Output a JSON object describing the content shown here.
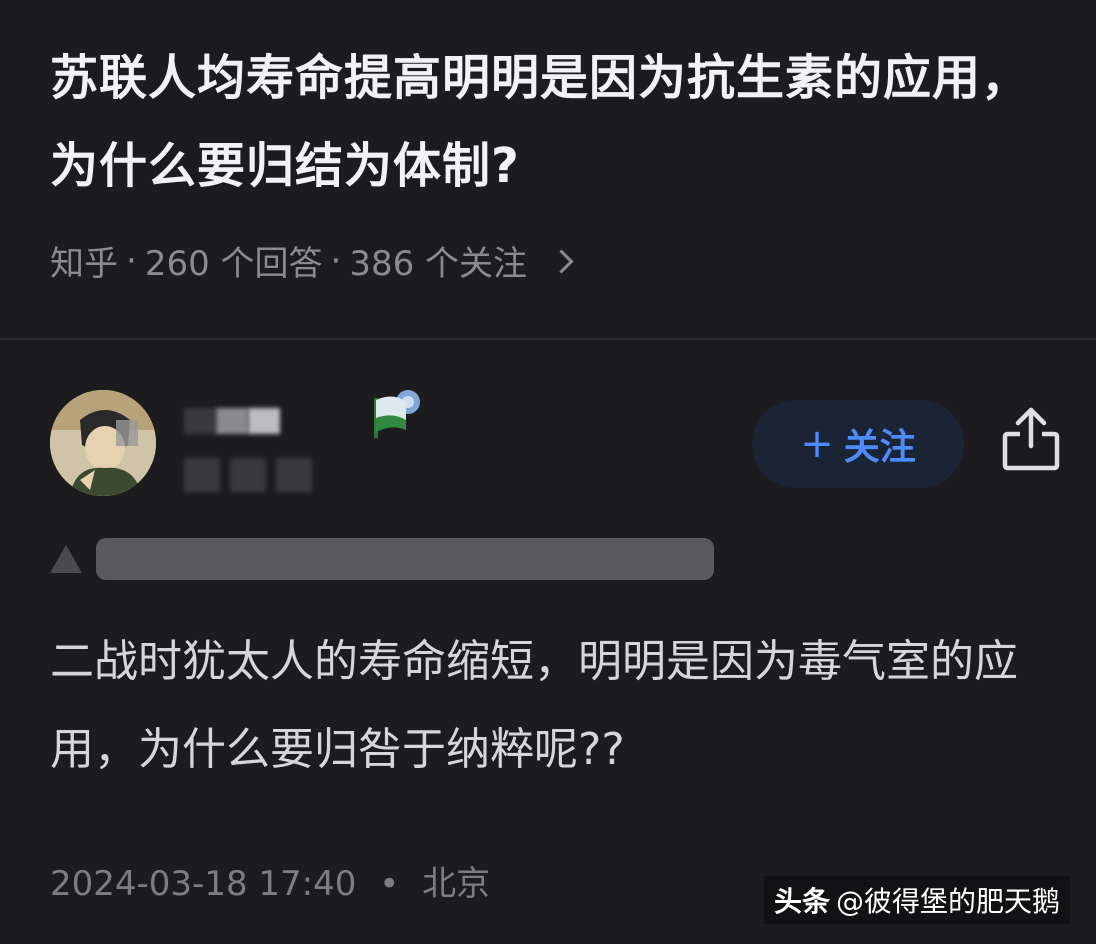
{
  "question": {
    "title": "苏联人均寿命提高明明是因为抗生素的应用，为什么要归结为体制?",
    "source": "知乎",
    "answers": "260 个回答",
    "followers": "386 个关注",
    "separator": "·"
  },
  "author": {
    "follow_button": "+ 关注",
    "follow_plus": "+",
    "follow_label": "关注"
  },
  "answer": {
    "text": "二战时犹太人的寿命缩短，明明是因为毒气室的应用，为什么要归咎于纳粹呢??",
    "date": "2024-03-18 17:40",
    "dot": "•",
    "location": "北京"
  },
  "watermark": {
    "brand": "头条",
    "handle": "@彼得堡的肥天鹅"
  },
  "colors": {
    "background": "#1c1c1f",
    "accent": "#4d8cff",
    "follow_bg": "#1b2434"
  },
  "icons": [
    "chevron-right-icon",
    "avatar",
    "flag-badge-icon",
    "plus-icon",
    "share-icon",
    "collapse-triangle-icon"
  ]
}
